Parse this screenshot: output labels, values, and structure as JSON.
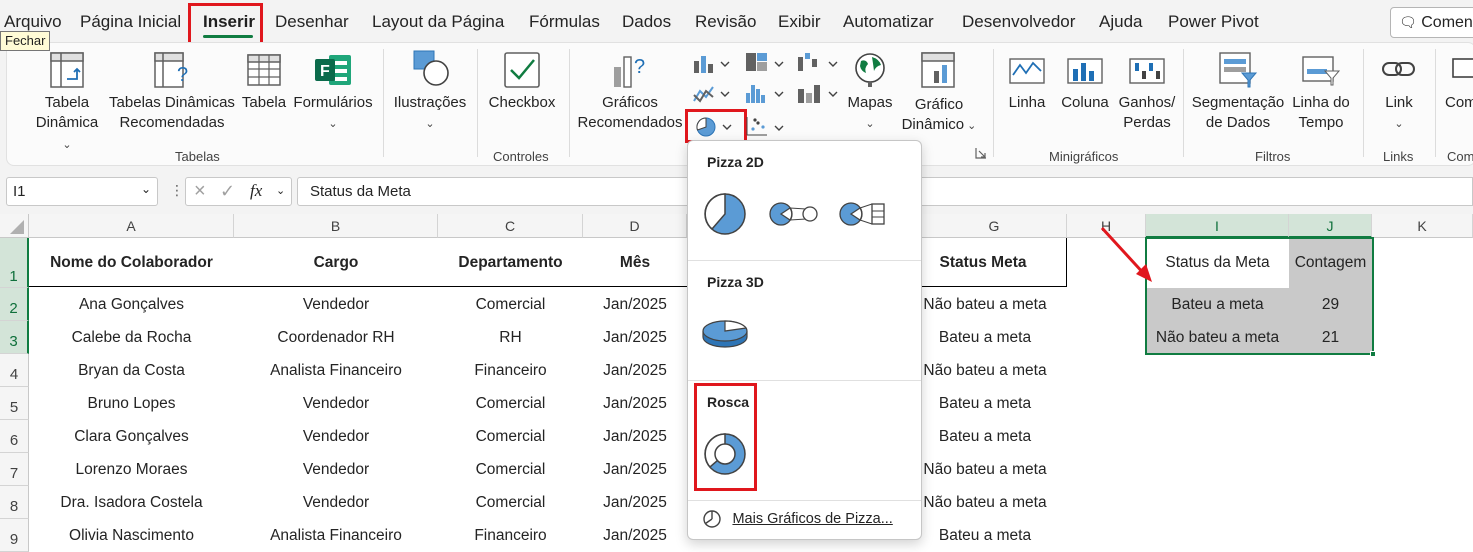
{
  "menu": {
    "tabs": [
      "Arquivo",
      "Página Inicial",
      "Inserir",
      "Desenhar",
      "Layout da Página",
      "Fórmulas",
      "Dados",
      "Revisão",
      "Exibir",
      "Automatizar",
      "Desenvolvedor",
      "Ajuda",
      "Power Pivot"
    ],
    "active_tab": "Inserir",
    "tooltip": "Fechar",
    "comments_label": "Coment"
  },
  "ribbon": {
    "tabelas": {
      "group_label": "Tabelas",
      "tabela_dinamica": "Tabela Dinâmica",
      "tabelas_dinamicas_recomendadas": "Tabelas Dinâmicas Recomendadas",
      "tabela": "Tabela",
      "formularios": "Formulários"
    },
    "ilustracoes": "Ilustrações",
    "controles": {
      "group_label": "Controles",
      "checkbox": "Checkbox"
    },
    "graficos": {
      "recomendados": "Gráficos Recomendados"
    },
    "mapas": "Mapas",
    "grafico_dinamico": "Gráfico Dinâmico",
    "minigraficos": {
      "group_label": "Minigráficos",
      "linha": "Linha",
      "coluna": "Coluna",
      "ganhos_perdas": "Ganhos/ Perdas"
    },
    "filtros": {
      "group_label": "Filtros",
      "segmentacao": "Segmentação de Dados",
      "linha_do_tempo": "Linha do Tempo"
    },
    "links": {
      "group_label": "Links",
      "link": "Link"
    },
    "comentarios": {
      "label": "Com",
      "group_label": "Com"
    }
  },
  "formula_bar": {
    "name_box": "I1",
    "fx": "fx",
    "formula": "Status da Meta"
  },
  "sheet": {
    "columns": [
      "A",
      "B",
      "C",
      "D",
      "G",
      "H",
      "I",
      "J",
      "K"
    ],
    "rows": [
      "1",
      "2",
      "3",
      "4",
      "5",
      "6",
      "7",
      "8",
      "9"
    ],
    "headers": [
      "Nome do Colaborador",
      "Cargo",
      "Departamento",
      "Mês",
      "Status Meta"
    ],
    "data": [
      [
        "Ana Gonçalves",
        "Vendedor",
        "Comercial",
        "Jan/2025",
        "Não bateu a meta"
      ],
      [
        "Calebe da Rocha",
        "Coordenador RH",
        "RH",
        "Jan/2025",
        "Bateu a meta"
      ],
      [
        "Bryan da Costa",
        "Analista Financeiro",
        "Financeiro",
        "Jan/2025",
        "Não bateu a meta"
      ],
      [
        "Bruno Lopes",
        "Vendedor",
        "Comercial",
        "Jan/2025",
        "Bateu a meta"
      ],
      [
        "Clara Gonçalves",
        "Vendedor",
        "Comercial",
        "Jan/2025",
        "Bateu a meta"
      ],
      [
        "Lorenzo Moraes",
        "Vendedor",
        "Comercial",
        "Jan/2025",
        "Não bateu a meta"
      ],
      [
        "Dra. Isadora Costela",
        "Vendedor",
        "Comercial",
        "Jan/2025",
        "Não bateu a meta"
      ],
      [
        "Olivia Nascimento",
        "Analista Financeiro",
        "Financeiro",
        "Jan/2025",
        "Bateu a meta"
      ]
    ],
    "summary": {
      "headers": [
        "Status da Meta",
        "Contagem"
      ],
      "rows": [
        [
          "Bateu a meta",
          "29"
        ],
        [
          "Não bateu a meta",
          "21"
        ]
      ]
    }
  },
  "pie_dropdown": {
    "section_2d": "Pizza 2D",
    "section_3d": "Pizza 3D",
    "section_rosca": "Rosca",
    "more": "Mais Gráficos de Pizza..."
  },
  "colors": {
    "accent_green": "#107c41",
    "highlight_red": "#e0171d",
    "chart_blue": "#5b9bd5"
  }
}
